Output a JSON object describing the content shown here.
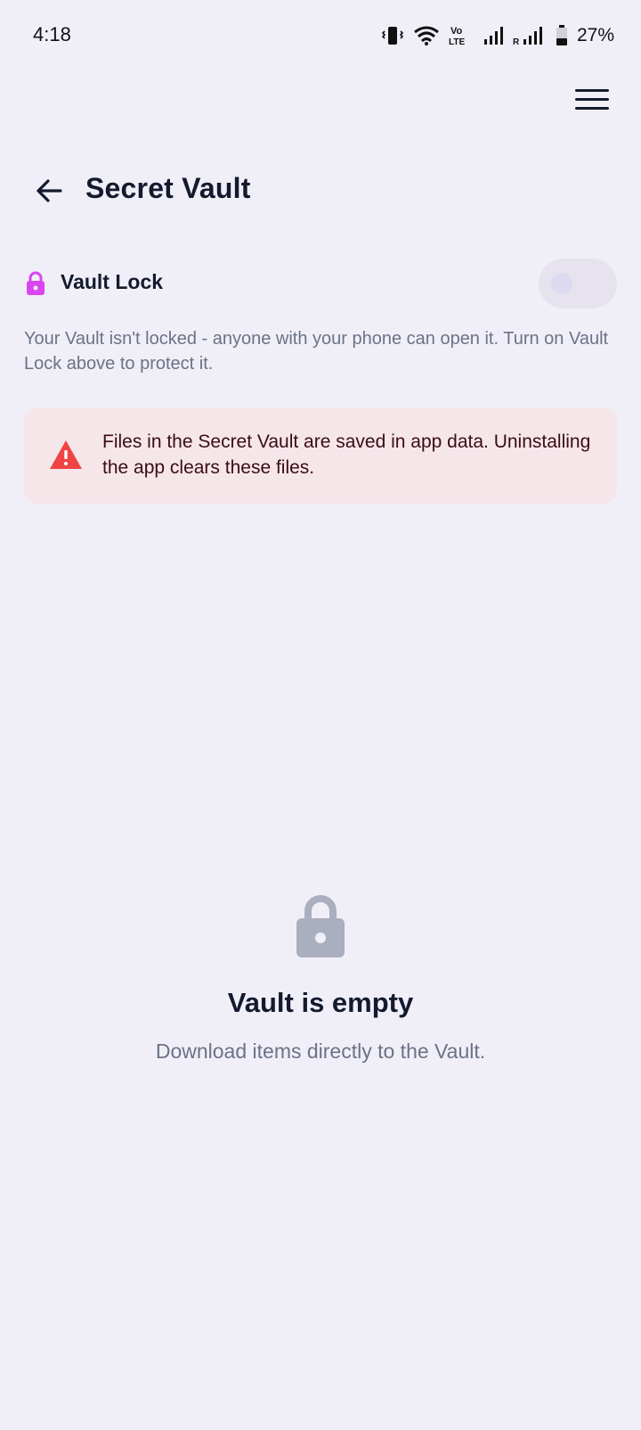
{
  "status_bar": {
    "time": "4:18",
    "battery": "27%",
    "icons": [
      "vibrate-icon",
      "wifi-icon",
      "volte-icon",
      "signal-icon",
      "roaming-signal-icon",
      "battery-icon"
    ]
  },
  "header": {
    "title": "Secret Vault",
    "back_icon": "arrow-left-icon",
    "menu_icon": "hamburger-menu-icon"
  },
  "vault_lock": {
    "label": "Vault Lock",
    "icon": "lock-icon",
    "icon_color": "#d946ef",
    "enabled": false,
    "description": "Your Vault isn't locked - anyone with your phone can open it. Turn on Vault Lock above to protect it."
  },
  "warning": {
    "icon": "warning-triangle-icon",
    "icon_color": "#ef4444",
    "background": "#f5e6ea",
    "text": "Files in the Secret Vault are saved in app data. Uninstalling the app clears these files."
  },
  "empty_state": {
    "icon": "lock-icon",
    "title": "Vault is empty",
    "subtitle": "Download items directly to the Vault."
  }
}
